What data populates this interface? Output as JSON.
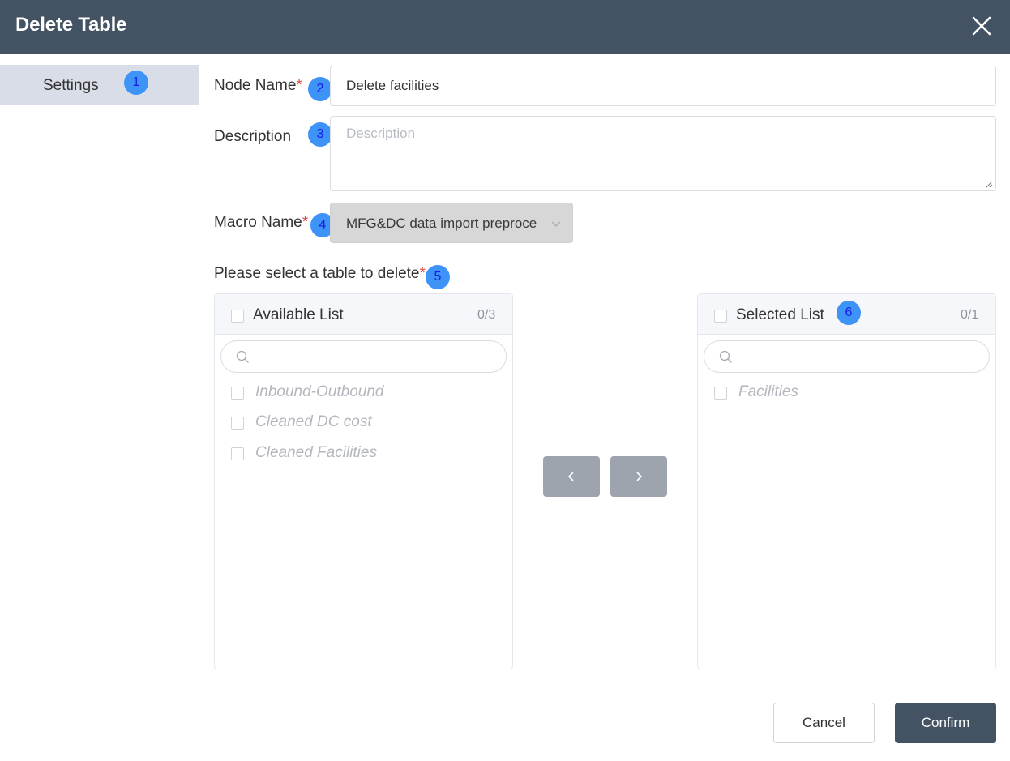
{
  "dialog": {
    "title": "Delete Table"
  },
  "sidebar": {
    "items": [
      {
        "label": "Settings",
        "badge": "1"
      }
    ]
  },
  "form": {
    "node_name": {
      "label": "Node Name",
      "required_mark": "*",
      "value": "Delete facilities",
      "badge": "2"
    },
    "description": {
      "label": "Description",
      "placeholder": "Description",
      "value": "",
      "badge": "3"
    },
    "macro_name": {
      "label": "Macro Name",
      "required_mark": "*",
      "value": "MFG&DC data import preproce",
      "badge": "4"
    },
    "table_select": {
      "label": "Please select a table to delete",
      "required_mark": "*",
      "badge": "5"
    }
  },
  "transfer": {
    "available": {
      "title": "Available List",
      "count": "0/3",
      "items": [
        "Inbound-Outbound",
        "Cleaned DC cost",
        "Cleaned Facilities"
      ]
    },
    "selected": {
      "title": "Selected List",
      "count": "0/1",
      "badge": "6",
      "items": [
        "Facilities"
      ]
    }
  },
  "footer": {
    "cancel_label": "Cancel",
    "confirm_label": "Confirm"
  },
  "colors": {
    "header_bg": "#435363",
    "badge_bg": "#3d94f6",
    "required": "#e2453c",
    "sidebar_active_bg": "#d9dde8"
  },
  "icons": {
    "close": "close-icon",
    "chevron": "chevron-down-icon",
    "search": "search-icon",
    "left": "chevron-left-icon",
    "right": "chevron-right-icon"
  }
}
